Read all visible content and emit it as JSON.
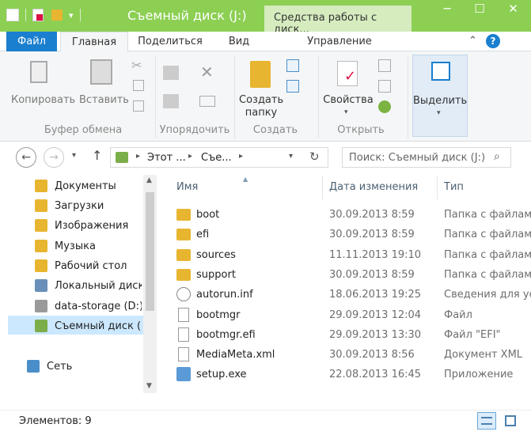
{
  "window": {
    "title": "Съемный диск (J:)",
    "context_group": "Средства работы с диск...",
    "minimize": "─",
    "maximize": "☐",
    "close": "✕"
  },
  "ribbon_tabs": {
    "file": "Файл",
    "home": "Главная",
    "share": "Поделиться",
    "view": "Вид",
    "manage": "Управление"
  },
  "ribbon": {
    "copy": "Копировать",
    "paste": "Вставить",
    "clipboard_group": "Буфер обмена",
    "organize_group": "Упорядочить",
    "new_folder_line1": "Создать",
    "new_folder_line2": "папку",
    "create_group": "Создать",
    "properties": "Свойства",
    "open_group": "Открыть",
    "select": "Выделить"
  },
  "address": {
    "crumb1": "Этот ...",
    "crumb2": "Съе...",
    "search_placeholder": "Поиск: Съемный диск (J:)"
  },
  "nav_pane": {
    "items": [
      {
        "label": "Документы",
        "icon": "documents-icon"
      },
      {
        "label": "Загрузки",
        "icon": "downloads-icon"
      },
      {
        "label": "Изображения",
        "icon": "pictures-icon"
      },
      {
        "label": "Музыка",
        "icon": "music-icon"
      },
      {
        "label": "Рабочий стол",
        "icon": "desktop-icon"
      },
      {
        "label": "Локальный диск",
        "icon": "local-disk-icon"
      },
      {
        "label": "data-storage (D:)",
        "icon": "drive-icon"
      },
      {
        "label": "Съемный диск (...",
        "icon": "removable-drive-icon"
      },
      {
        "label": "Сеть",
        "icon": "network-icon"
      }
    ]
  },
  "columns": {
    "name": "Имя",
    "date": "Дата изменения",
    "type": "Тип"
  },
  "files": [
    {
      "name": "boot",
      "date": "30.09.2013 8:59",
      "type": "Папка с файлами",
      "icon": "folder-icon"
    },
    {
      "name": "efi",
      "date": "30.09.2013 8:59",
      "type": "Папка с файлами",
      "icon": "folder-icon"
    },
    {
      "name": "sources",
      "date": "11.11.2013 19:10",
      "type": "Папка с файлами",
      "icon": "folder-icon"
    },
    {
      "name": "support",
      "date": "30.09.2013 8:59",
      "type": "Папка с файлами",
      "icon": "folder-icon"
    },
    {
      "name": "autorun.inf",
      "date": "18.06.2013 19:25",
      "type": "Сведения для уст",
      "icon": "settings-file-icon"
    },
    {
      "name": "bootmgr",
      "date": "29.09.2013 12:04",
      "type": "Файл",
      "icon": "file-icon"
    },
    {
      "name": "bootmgr.efi",
      "date": "29.09.2013 13:30",
      "type": "Файл \"EFI\"",
      "icon": "file-icon"
    },
    {
      "name": "MediaMeta.xml",
      "date": "30.09.2013 8:56",
      "type": "Документ XML",
      "icon": "file-icon"
    },
    {
      "name": "setup.exe",
      "date": "22.08.2013 16:45",
      "type": "Приложение",
      "icon": "setup-icon"
    }
  ],
  "status": {
    "items_count": "Элементов: 9"
  },
  "colors": {
    "accent": "#1a7fcf",
    "title_bar": "#8ccf53",
    "selection": "#cce8ff",
    "folder": "#e8b530"
  }
}
